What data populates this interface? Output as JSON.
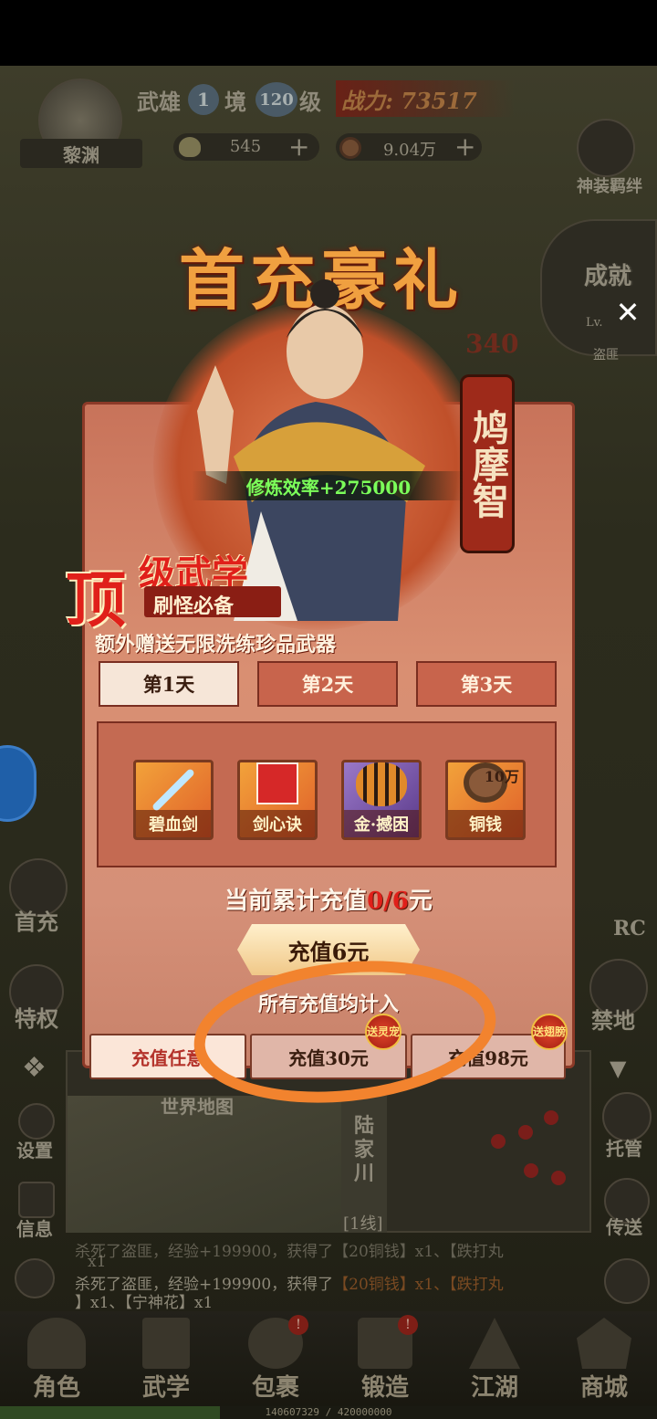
{
  "player": {
    "name": "黎渊",
    "rank_prefix": "武雄",
    "realm_level": "1",
    "realm_label": "境",
    "level_value": "120",
    "level_label": "级",
    "power_text": "战力: 73517",
    "silver": "545",
    "copper": "9.04万"
  },
  "side_right": {
    "shenzhuang": "神装羁绊",
    "chengjiu": "成就",
    "avatar_tag": "Lv.",
    "avatar_name": "盗匪",
    "jindi": "禁地",
    "tuoguan": "托管",
    "chuansong": "传送",
    "chongzhi_bg": "RC",
    "hidden_number": "340"
  },
  "side_left": {
    "shouchong": "首充",
    "tequan": "特权",
    "shezhi": "设置",
    "xinxi": "信息"
  },
  "popup": {
    "title": "首充豪礼",
    "hero_name": "鸠摩智",
    "efficiency": "修炼效率+275000",
    "banner_big": "顶",
    "banner_title": "级武学",
    "banner_sub": "刷怪必备",
    "extra_gift": "额外赠送无限洗练珍品武器",
    "day_tabs": [
      "第1天",
      "第2天",
      "第3天"
    ],
    "items": [
      {
        "label": "碧血剑",
        "icon": "sword-icon",
        "count": ""
      },
      {
        "label": "剑心诀",
        "icon": "book-icon",
        "count": ""
      },
      {
        "label": "金·撼困",
        "icon": "tiger-icon",
        "count": ""
      },
      {
        "label": "铜钱",
        "icon": "coin-icon",
        "count": "10万"
      }
    ],
    "progress_prefix": "当前累计充值",
    "progress_current": "0",
    "progress_sep": "/",
    "progress_target": "6",
    "progress_suffix": "元",
    "recharge_button": "充值6元",
    "note": "所有充值均计入",
    "bottom_tabs": [
      {
        "label": "充值任意",
        "badge": ""
      },
      {
        "label": "充值30元",
        "badge": "送灵宠"
      },
      {
        "label": "充值98元",
        "badge": "送翅膀"
      }
    ],
    "close_label": "✕"
  },
  "map": {
    "title": "世界地图",
    "location": "陆家川",
    "line": "[1线]"
  },
  "chat": {
    "line1_a": "杀死了盗匪，经验+199900，获得了",
    "line1_b": "【20铜钱】x1、【跌打丸",
    "line2": "】x1、【宁神花】x1",
    "prev_line": "杀死了盗匪，经验+199900，获得了【20铜钱】x1、【跌打丸",
    "prev_tail": "x1"
  },
  "nav": [
    {
      "label": "角色",
      "icon": "hat-icon"
    },
    {
      "label": "武学",
      "icon": "scroll-icon"
    },
    {
      "label": "包裹",
      "icon": "bag-icon"
    },
    {
      "label": "锻造",
      "icon": "anvil-icon"
    },
    {
      "label": "江湖",
      "icon": "pagoda-icon"
    },
    {
      "label": "商城",
      "icon": "shop-icon"
    }
  ],
  "exp": {
    "text": "140607329 / 420000000",
    "fraction": 0.335
  },
  "colors": {
    "popup_bg": "#d98f72",
    "title_gold": "#f0a040",
    "efficiency_green": "#7cff5a",
    "highlight_red": "#e0201a",
    "annotation_orange": "#f2832e"
  }
}
